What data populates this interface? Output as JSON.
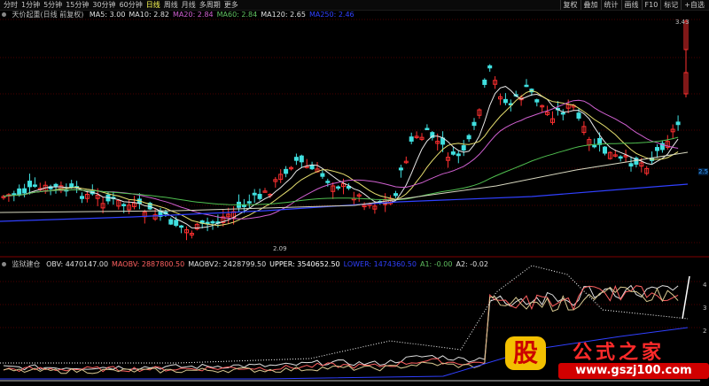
{
  "toolbar": {
    "periods": [
      "分时",
      "1分钟",
      "5分钟",
      "15分钟",
      "30分钟",
      "60分钟",
      "日线",
      "周线",
      "月线",
      "多周期",
      "更多"
    ],
    "active_period": "日线",
    "tools": [
      "复权",
      "叠加",
      "统计",
      "画线",
      "F10",
      "标记",
      "+自选"
    ]
  },
  "main_panel": {
    "title": "天价起重(日线 前复权)",
    "indicators": [
      {
        "label": "MA5: 3.00",
        "color": "#e0e0e0"
      },
      {
        "label": "MA10: 2.82",
        "color": "#e0e0e0"
      },
      {
        "label": "MA20: 2.84",
        "color": "#d060d0"
      },
      {
        "label": "MA60: 2.84",
        "color": "#60c060"
      },
      {
        "label": "MA120: 2.65",
        "color": "#e0e0e0"
      },
      {
        "label": "MA250: 2.46",
        "color": "#3040ff"
      }
    ],
    "high_label": "3.43",
    "low_label": "2.09",
    "right_tag": "2.5"
  },
  "sub_panel": {
    "title": "监狱建仓",
    "indicators": [
      {
        "label": "OBV: 4470147.00",
        "color": "#e0e0e0"
      },
      {
        "label": "MAOBV: 2887800.50",
        "color": "#ff6060"
      },
      {
        "label": "MAOBV2: 2428799.50",
        "color": "#e0e0e0"
      },
      {
        "label": "UPPER: 3540652.50",
        "color": "#ffffff"
      },
      {
        "label": "LOWER: 1474360.50",
        "color": "#3040ff"
      },
      {
        "label": "A1: -0.00",
        "color": "#60c060"
      },
      {
        "label": "A2: -0.02",
        "color": "#e0e0e0"
      }
    ],
    "right_ticks": [
      "4",
      "3",
      "2"
    ]
  },
  "logo": {
    "char": "股",
    "title": "公式之家",
    "url": "www.gszj100.com"
  },
  "colors": {
    "up": "#ff3030",
    "down": "#40e0e0",
    "bg": "#000000"
  }
}
